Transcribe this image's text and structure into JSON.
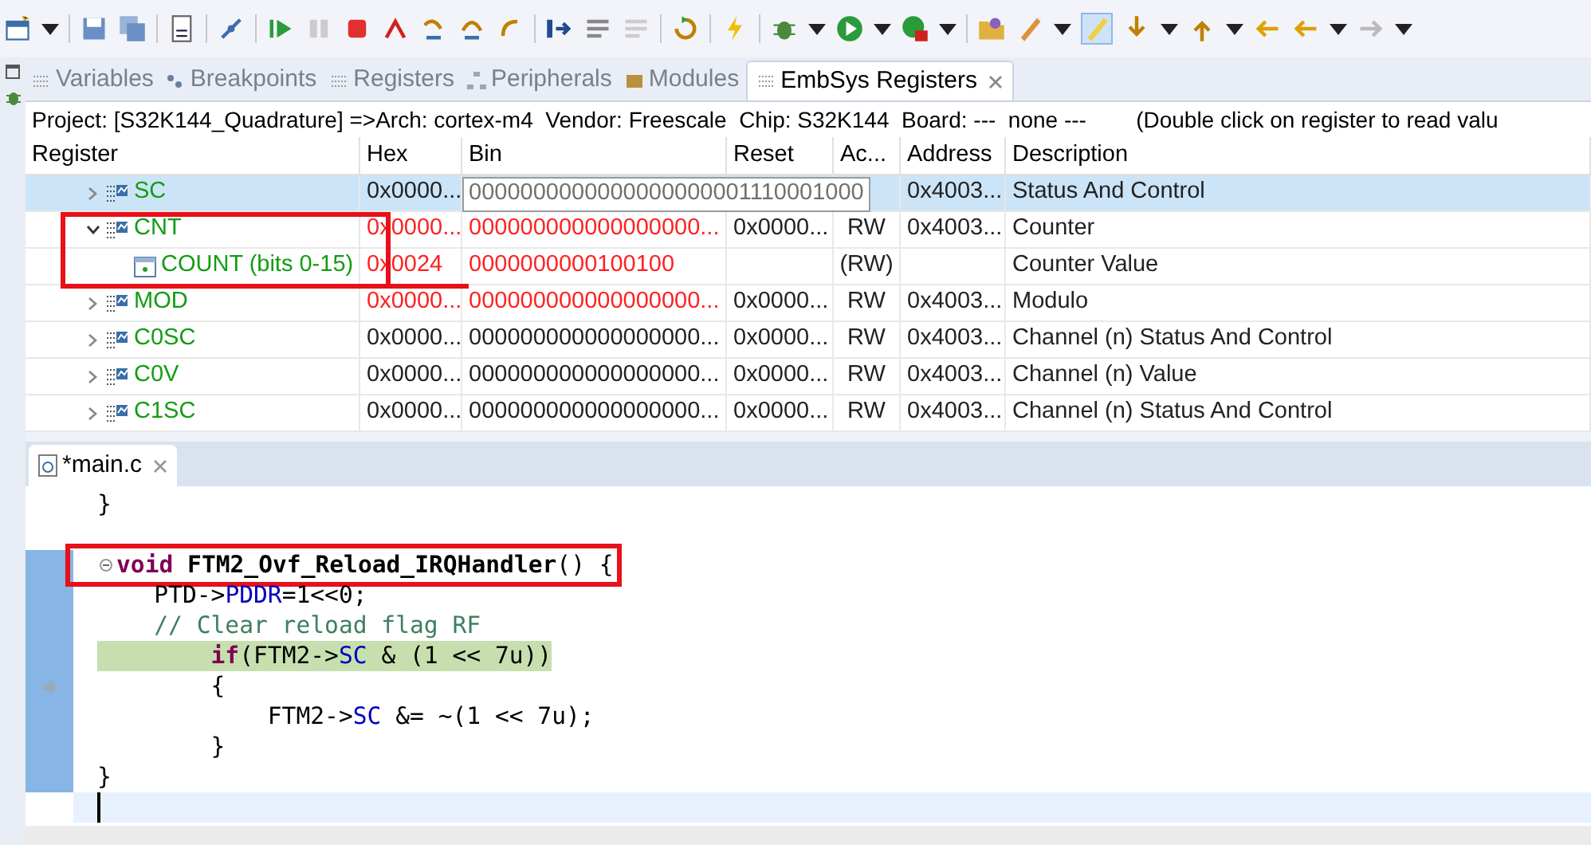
{
  "view_tabs": [
    {
      "label": "Variables",
      "selected": false
    },
    {
      "label": "Breakpoints",
      "selected": false
    },
    {
      "label": "Registers",
      "selected": false
    },
    {
      "label": "Peripherals",
      "selected": false
    },
    {
      "label": "Modules",
      "selected": false
    },
    {
      "label": "EmbSys Registers",
      "selected": true
    }
  ],
  "info_line": "Project: [S32K144_Quadrature] =>Arch: cortex-m4  Vendor: Freescale  Chip: S32K144  Board: ---  none ---        (Double click on register to read valu",
  "table": {
    "columns": [
      "Register",
      "Hex",
      "Bin",
      "Reset",
      "Ac...",
      "Address",
      "Description"
    ],
    "rows": [
      {
        "kind": "register",
        "name": "SC",
        "hex": "0x0000...",
        "bin": "0000000000000000000001110001000",
        "reset": "",
        "access": "",
        "address": "0x4003...",
        "description": "Status And Control",
        "expanded": false,
        "selected": true,
        "editing": true,
        "changed": false
      },
      {
        "kind": "register",
        "name": "CNT",
        "hex": "0x0000...",
        "bin": "000000000000000000...",
        "reset": "0x0000...",
        "access": "RW",
        "address": "0x4003...",
        "description": "Counter",
        "expanded": true,
        "selected": false,
        "editing": false,
        "changed": true,
        "annotated": true,
        "children": [
          {
            "kind": "field",
            "name": "COUNT (bits 0-15)",
            "hex": "0x0024",
            "bin": "0000000000100100",
            "access": "(RW)",
            "description": "Counter Value",
            "selected": false,
            "editing": false,
            "changed": true,
            "annotated": true,
            "underlined": true
          }
        ]
      },
      {
        "kind": "register",
        "name": "MOD",
        "hex": "0x0000...",
        "bin": "000000000000000000...",
        "reset": "0x0000...",
        "access": "RW",
        "address": "0x4003...",
        "description": "Modulo",
        "expanded": false,
        "selected": false,
        "editing": false,
        "changed": true
      },
      {
        "kind": "register",
        "name": "C0SC",
        "hex": "0x0000...",
        "bin": "000000000000000000...",
        "reset": "0x0000...",
        "access": "RW",
        "address": "0x4003...",
        "description": "Channel (n) Status And Control",
        "expanded": false,
        "selected": false,
        "editing": false,
        "changed": false
      },
      {
        "kind": "register",
        "name": "C0V",
        "hex": "0x0000...",
        "bin": "000000000000000000...",
        "reset": "0x0000...",
        "access": "RW",
        "address": "0x4003...",
        "description": "Channel (n) Value",
        "expanded": false,
        "selected": false,
        "editing": false,
        "changed": false
      },
      {
        "kind": "register",
        "name": "C1SC",
        "hex": "0x0000...",
        "bin": "000000000000000000...",
        "reset": "0x0000...",
        "access": "RW",
        "address": "0x4003...",
        "description": "Channel (n) Status And Control",
        "expanded": false,
        "selected": false,
        "editing": false,
        "changed": false
      }
    ]
  },
  "editor": {
    "tab": {
      "label": "*main.c",
      "selected": true
    },
    "lines": [
      {
        "segments": [
          {
            "kind": "plain",
            "text": "}"
          }
        ]
      },
      {
        "kind": "blank"
      },
      {
        "segments": [
          {
            "kind": "keyword",
            "text": "void"
          },
          {
            "kind": "bold",
            "text": " FTM2_Ovf_Reload_IRQHandler"
          },
          {
            "kind": "plain",
            "text": "() {"
          }
        ],
        "annotated": true
      },
      {
        "segments": [
          {
            "kind": "plain",
            "text": "    PTD->"
          },
          {
            "kind": "field",
            "text": "PDDR"
          },
          {
            "kind": "plain",
            "text": "=1<<0;"
          }
        ]
      },
      {
        "segments": [
          {
            "kind": "comment",
            "text": "    // Clear reload flag RF"
          }
        ]
      },
      {
        "segments": [
          {
            "kind": "keyword",
            "text": "        if"
          },
          {
            "kind": "plain",
            "text": "(FTM2->"
          },
          {
            "kind": "field",
            "text": "SC"
          },
          {
            "kind": "plain",
            "text": " & (1 << 7u))"
          }
        ],
        "highlighted": true
      },
      {
        "segments": [
          {
            "kind": "plain",
            "text": "        {"
          }
        ]
      },
      {
        "segments": [
          {
            "kind": "plain",
            "text": "            FTM2->"
          },
          {
            "kind": "field",
            "text": "SC"
          },
          {
            "kind": "plain",
            "text": " &= ~(1 << 7u);"
          }
        ]
      },
      {
        "segments": [
          {
            "kind": "plain",
            "text": "        }"
          }
        ]
      },
      {
        "segments": [
          {
            "kind": "plain",
            "text": "}"
          }
        ]
      }
    ]
  }
}
